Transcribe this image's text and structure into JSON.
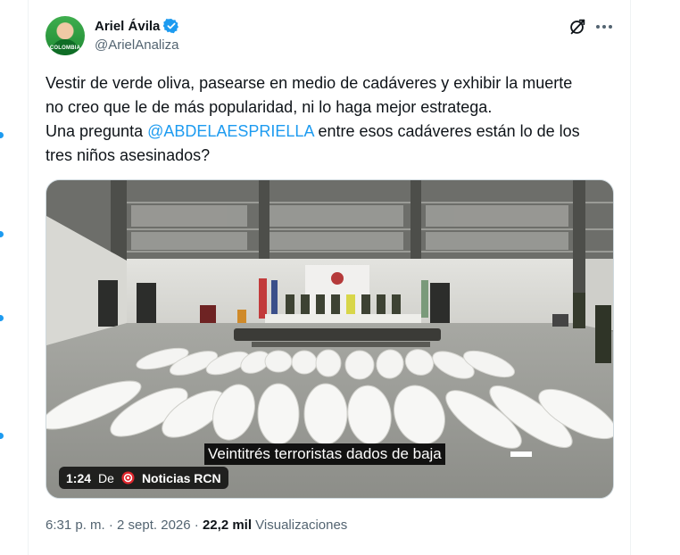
{
  "tweet": {
    "author": {
      "display_name": "Ariel Ávila",
      "handle": "@ArielAnaliza",
      "avatar_text": "COLOMBIA",
      "verified": true
    },
    "text": {
      "line1": "Vestir de verde oliva, pasearse en medio de cadáveres y exhibir la muerte",
      "line2": "no creo que le de más popularidad, ni lo haga mejor estratega.",
      "line3_prefix": "Una pregunta ",
      "line3_mention": "@ABDELAESPRIELLA",
      "line3_suffix": " entre esos cadáveres están lo de los",
      "line4": "tres niños asesinados?"
    },
    "media": {
      "caption": "Veintitrés terroristas dados de baja",
      "duration": "1:24",
      "from_label": "De",
      "source": "Noticias RCN"
    },
    "meta": {
      "time": "6:31 p. m.",
      "separator1": " · ",
      "date": "2 sept. 2026",
      "separator2": " · ",
      "views_count": "22,2 mil",
      "views_label": " Visualizaciones"
    },
    "icons": {
      "verified": "verified-badge-icon",
      "grok": "grok-icon",
      "more": "more-options-icon",
      "source": "rcn-logo-icon"
    },
    "colors": {
      "accent": "#1d9bf0",
      "text": "#0f1419",
      "secondary": "#536471"
    }
  }
}
